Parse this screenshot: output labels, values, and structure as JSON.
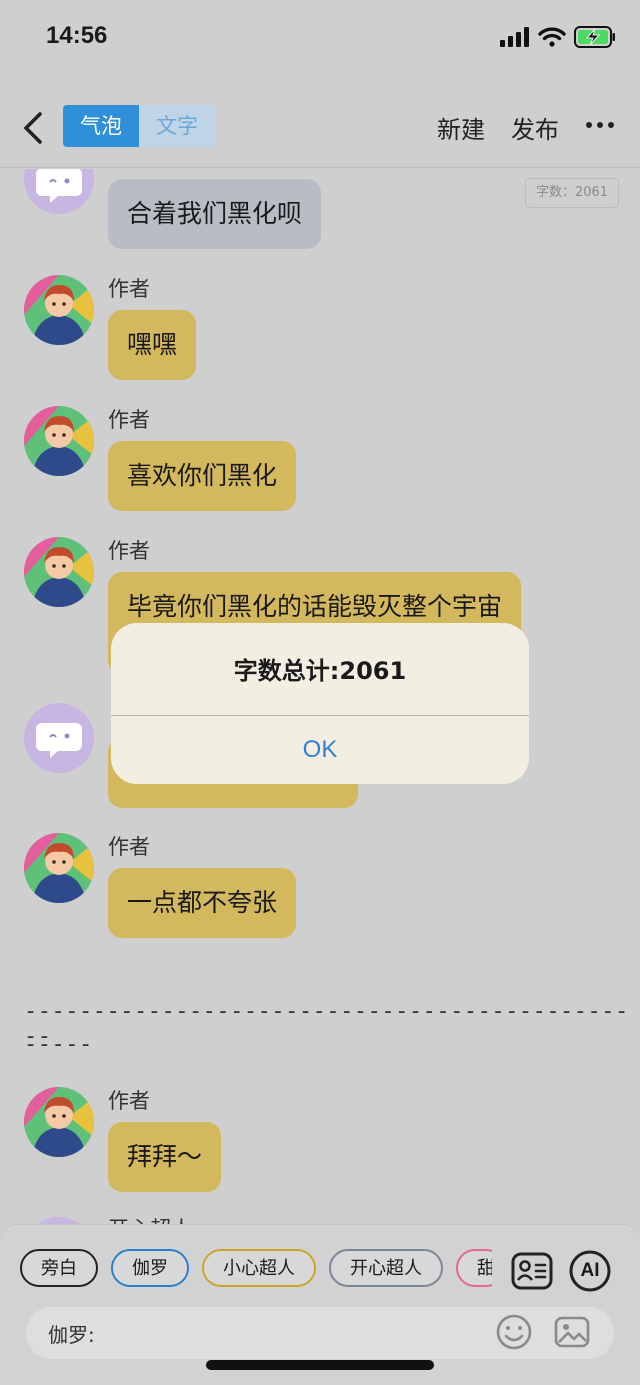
{
  "status": {
    "time": "14:56"
  },
  "nav": {
    "tabs": [
      {
        "label": "气泡",
        "active": true
      },
      {
        "label": "文字",
        "active": false
      }
    ],
    "new_label": "新建",
    "publish_label": "发布"
  },
  "chat": {
    "word_count_tag": "字数：2061",
    "messages": [
      {
        "sender": "",
        "text": "合着我们黑化呗",
        "avatar": "bot-avatar"
      },
      {
        "sender": "作者",
        "text": "嘿嘿",
        "avatar": "author-avatar"
      },
      {
        "sender": "作者",
        "text": "喜欢你们黑化",
        "avatar": "author-avatar"
      },
      {
        "sender": "作者",
        "text": "毕竟你们黑化的话能毁灭整个宇宙",
        "avatar": "author-avatar"
      },
      {
        "sender": "作者",
        "text": "一点都不夸张",
        "avatar": "author-avatar"
      },
      {
        "sender": "作者",
        "text": "拜拜～",
        "avatar": "author-avatar"
      }
    ],
    "divider_line1": "----------------------------------------------",
    "divider_line2": "-----",
    "partial_sender": "开心超人"
  },
  "dialog": {
    "title": "字数总计:2061",
    "ok_label": "OK"
  },
  "bottom": {
    "chips": [
      "旁白",
      "伽罗",
      "小心超人",
      "开心超人",
      "甜"
    ],
    "input_label": "伽罗:",
    "ai_label": "AI"
  },
  "colors": {
    "accent": "#2f8fd9",
    "bubble_yellow": "#d4b85e",
    "bubble_gray": "#b8bcc5",
    "dialog_button": "#2f7fd6"
  }
}
